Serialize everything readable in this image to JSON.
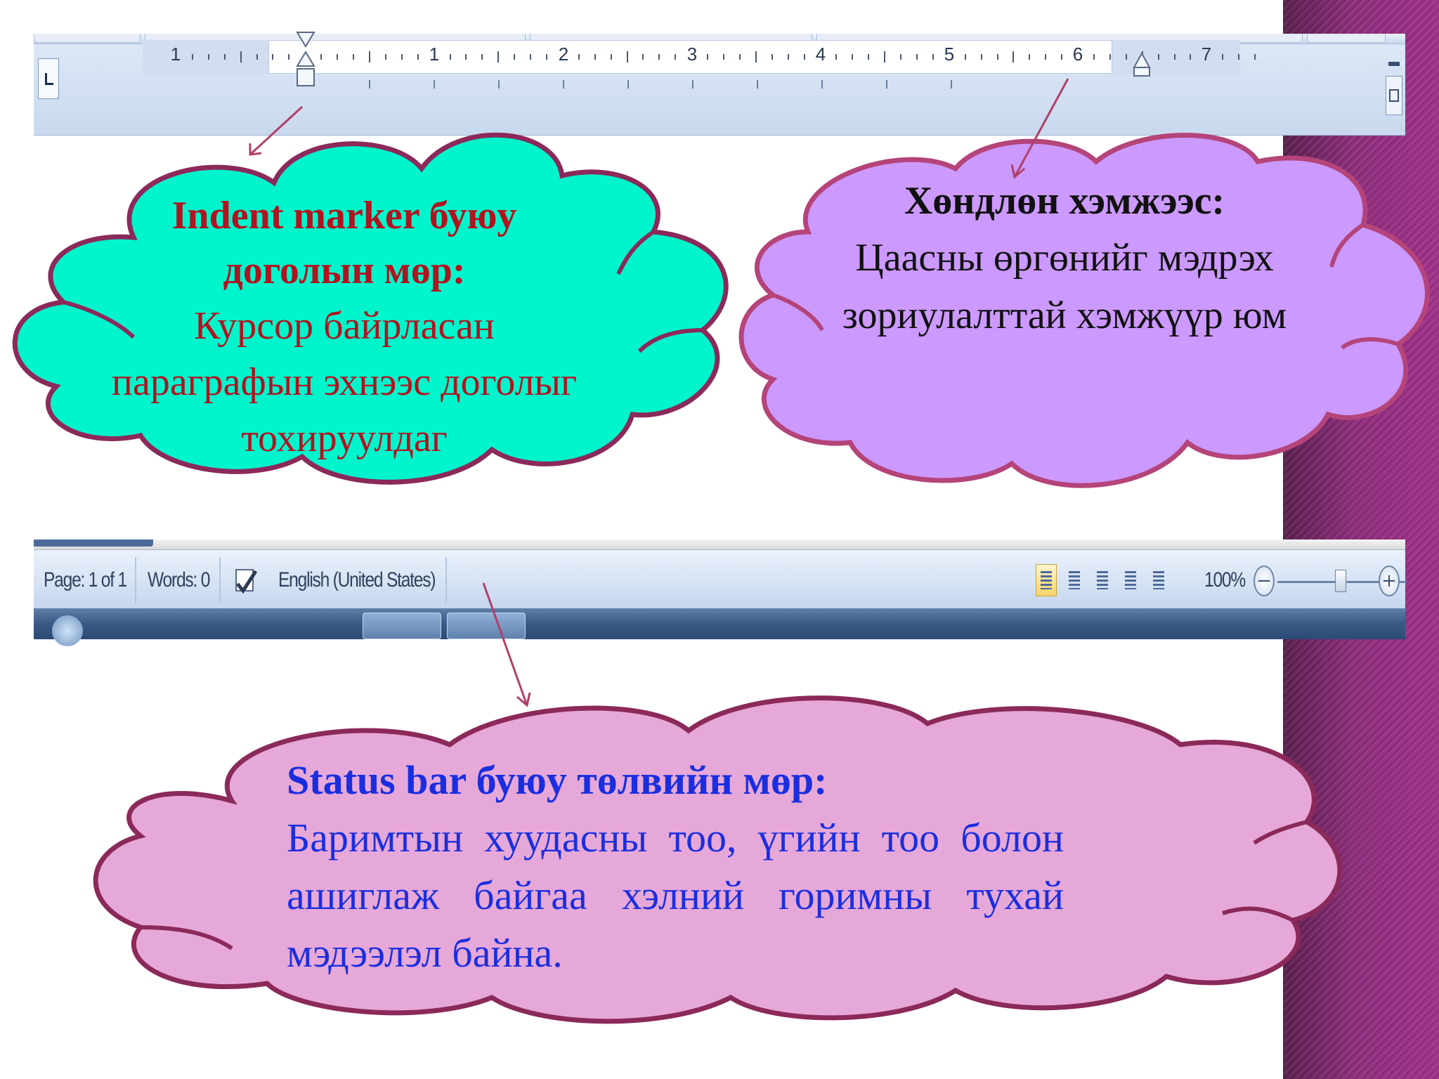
{
  "ruler": {
    "numbers": [
      "1",
      "1",
      "2",
      "3",
      "4",
      "5",
      "6",
      "7"
    ]
  },
  "status_bar": {
    "page": "Page: 1 of 1",
    "words": "Words: 0",
    "language": "English (United States)",
    "zoom": "100%",
    "zoom_minus": "−",
    "zoom_plus": "+"
  },
  "callouts": {
    "indent": {
      "heading": "Indent marker буюу доголын мөр:",
      "body": "Курсор байрласан параграфын эхнээс доголыг тохируулдаг"
    },
    "ruler": {
      "heading": "Хөндлөн хэмжээс:",
      "body": "Цаасны өргөнийг мэдрэх зориулалттай хэмжүүр юм"
    },
    "status": {
      "heading": "Status bar буюу төлвийн мөр:",
      "body": "Баримтын хуудасны тоо, үгийн тоо болон ашиглаж байгаа хэлний горимны тухай мэдээлэл байна."
    }
  },
  "colors": {
    "cloud_indent_fill": "#00f5cc",
    "cloud_ruler_fill": "#cc99ff",
    "cloud_status_fill": "#e6a8d8",
    "cloud_outline": "#8b2a5a",
    "arrow": "#b0406a",
    "side_stripe": "#8e2d7c"
  },
  "icons": [
    "tab-selector-icon",
    "indent-marker-icon",
    "right-indent-icon",
    "spelling-check-icon",
    "print-layout-icon",
    "full-screen-reading-icon",
    "web-layout-icon",
    "outline-icon",
    "draft-icon",
    "zoom-minus-icon",
    "zoom-plus-icon"
  ]
}
